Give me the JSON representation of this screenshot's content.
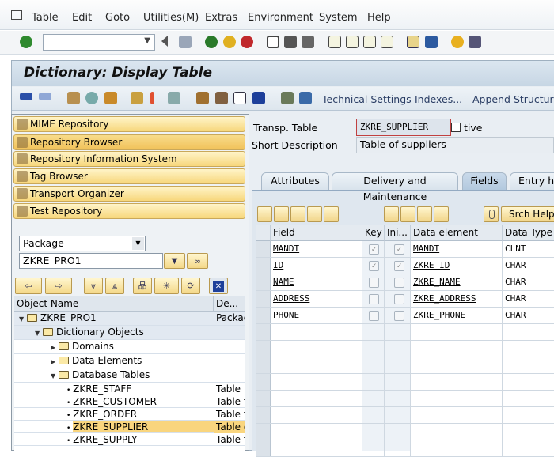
{
  "menu": [
    "Table",
    "Edit",
    "Goto",
    "Utilities(M)",
    "Extras",
    "Environment",
    "System",
    "Help"
  ],
  "command_field": {
    "value": ""
  },
  "title": "Dictionary: Display Table",
  "app_toolbar": {
    "links": [
      "Technical Settings",
      "Indexes...",
      "Append Structure..."
    ]
  },
  "left": {
    "nav_buttons": [
      "MIME Repository",
      "Repository Browser",
      "Repository Information System",
      "Tag Browser",
      "Transport Organizer",
      "Test Repository"
    ],
    "object_type": "Package",
    "object_name": "ZKRE_PRO1",
    "tree_headers": [
      "Object Name",
      "De..."
    ],
    "tree": [
      {
        "name": "ZKRE_PRO1",
        "desc": "Package",
        "level": 0,
        "kind": "open-folder"
      },
      {
        "name": "Dictionary Objects",
        "desc": "",
        "level": 1,
        "kind": "open-folder"
      },
      {
        "name": "Domains",
        "desc": "",
        "level": 2,
        "kind": "folder"
      },
      {
        "name": "Data Elements",
        "desc": "",
        "level": 2,
        "kind": "folder"
      },
      {
        "name": "Database Tables",
        "desc": "",
        "level": 2,
        "kind": "open-folder"
      },
      {
        "name": "ZKRE_STAFF",
        "desc": "Table fo",
        "level": 3,
        "kind": "leaf"
      },
      {
        "name": "ZKRE_CUSTOMER",
        "desc": "Table fo",
        "level": 3,
        "kind": "leaf"
      },
      {
        "name": "ZKRE_ORDER",
        "desc": "Table fo",
        "level": 3,
        "kind": "leaf"
      },
      {
        "name": "ZKRE_SUPPLIER",
        "desc": "Table o",
        "level": 3,
        "kind": "leaf",
        "selected": true
      },
      {
        "name": "ZKRE_SUPPLY",
        "desc": "Table fo",
        "level": 3,
        "kind": "leaf"
      }
    ]
  },
  "header": {
    "transp_label": "Transp. Table",
    "transp_value": "ZKRE_SUPPLIER",
    "status": "tive",
    "short_desc_label": "Short Description",
    "short_desc_value": "Table of suppliers"
  },
  "tabs": [
    {
      "label": "Attributes"
    },
    {
      "label": "Delivery and Maintenance"
    },
    {
      "label": "Fields",
      "active": true
    },
    {
      "label": "Entry he"
    }
  ],
  "grid_toolbar": {
    "srch_help": "Srch Help"
  },
  "grid": {
    "headers": [
      "Field",
      "Key",
      "Ini...",
      "Data element",
      "Data Type"
    ],
    "rows": [
      {
        "field": "MANDT",
        "key": true,
        "ini": true,
        "element": "MANDT",
        "type": "CLNT"
      },
      {
        "field": "ID",
        "key": true,
        "ini": true,
        "element": "ZKRE_ID",
        "type": "CHAR"
      },
      {
        "field": "NAME",
        "key": false,
        "ini": false,
        "element": "ZKRE_NAME",
        "type": "CHAR"
      },
      {
        "field": "ADDRESS",
        "key": false,
        "ini": false,
        "element": "ZKRE_ADDRESS",
        "type": "CHAR"
      },
      {
        "field": "PHONE",
        "key": false,
        "ini": false,
        "element": "ZKRE_PHONE",
        "type": "CHAR"
      }
    ]
  }
}
